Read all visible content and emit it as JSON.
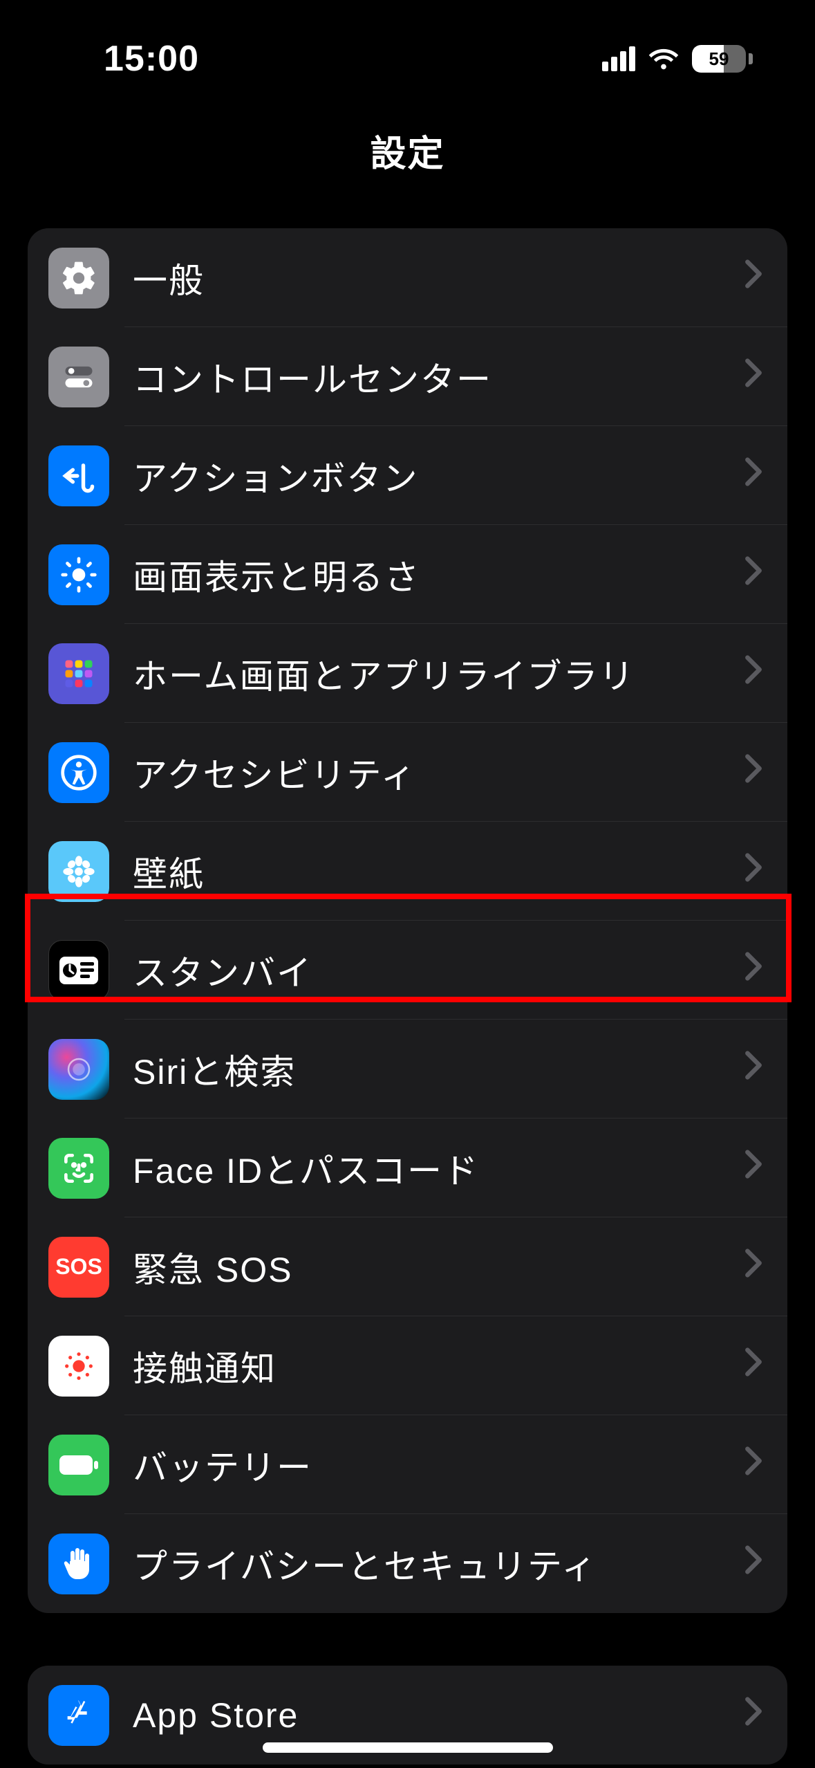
{
  "status": {
    "time": "15:00",
    "battery": "59"
  },
  "header": {
    "title": "設定"
  },
  "section1": {
    "items": [
      {
        "id": "general",
        "label": "一般"
      },
      {
        "id": "control-center",
        "label": "コントロールセンター"
      },
      {
        "id": "action-button",
        "label": "アクションボタン"
      },
      {
        "id": "display",
        "label": "画面表示と明るさ"
      },
      {
        "id": "home-screen",
        "label": "ホーム画面とアプリライブラリ"
      },
      {
        "id": "accessibility",
        "label": "アクセシビリティ"
      },
      {
        "id": "wallpaper",
        "label": "壁紙"
      },
      {
        "id": "standby",
        "label": "スタンバイ"
      },
      {
        "id": "siri",
        "label": "Siriと検索"
      },
      {
        "id": "faceid",
        "label": "Face IDとパスコード"
      },
      {
        "id": "sos",
        "label": "緊急 SOS"
      },
      {
        "id": "exposure",
        "label": "接触通知"
      },
      {
        "id": "battery",
        "label": "バッテリー"
      },
      {
        "id": "privacy",
        "label": "プライバシーとセキュリティ"
      }
    ]
  },
  "section2": {
    "items": [
      {
        "id": "appstore",
        "label": "App Store"
      }
    ]
  },
  "highlight": {
    "target": "accessibility"
  },
  "sos_icon_text": "SOS"
}
